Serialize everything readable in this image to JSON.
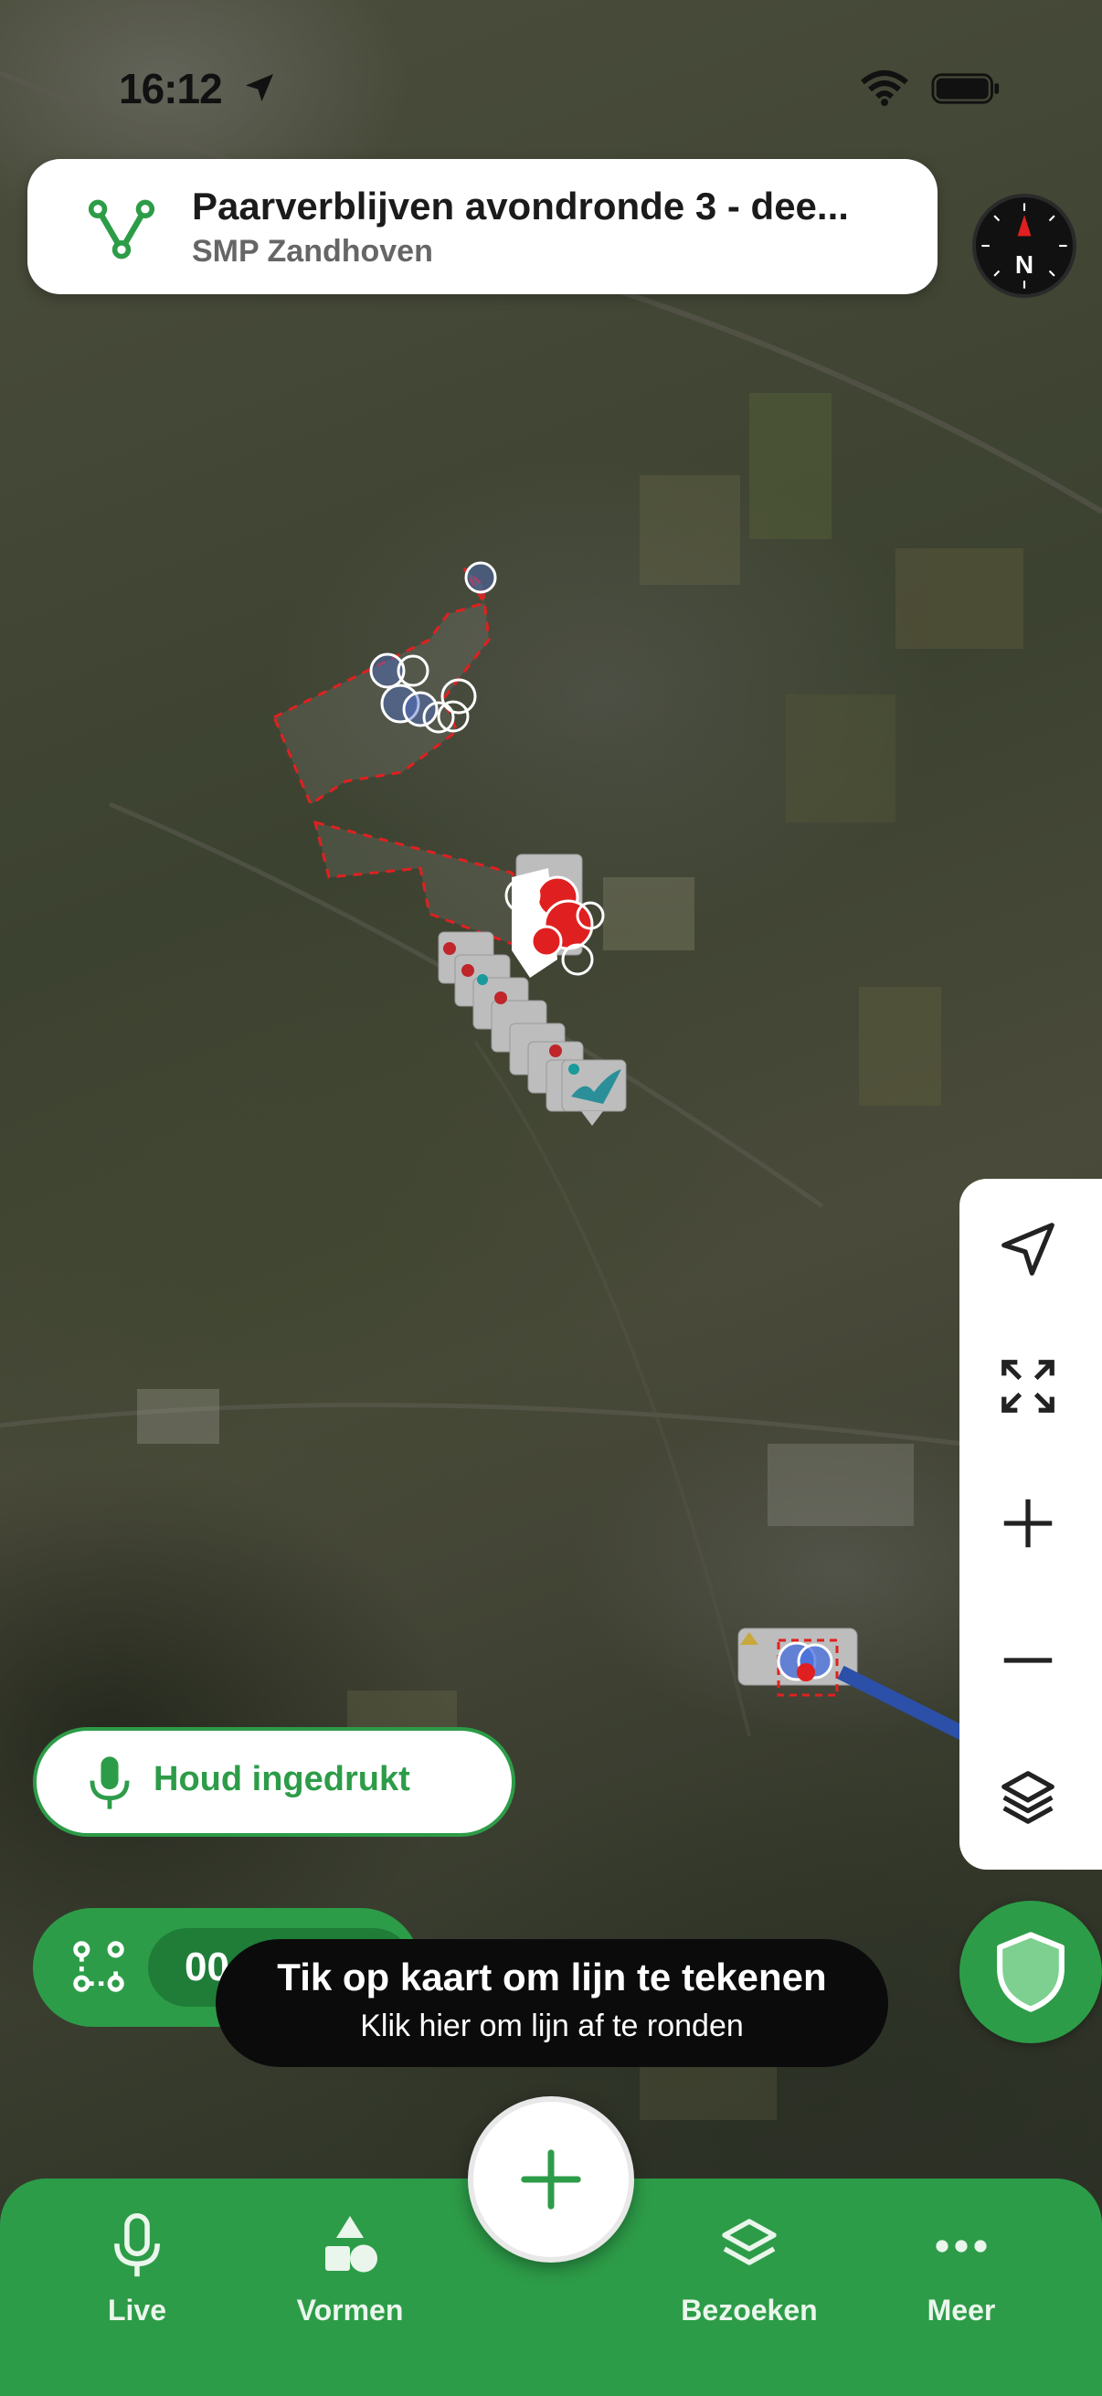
{
  "status_bar": {
    "time": "16:12"
  },
  "header": {
    "title": "Paarverblijven avondronde 3 - dee...",
    "subtitle": "SMP Zandhoven",
    "route_icon": "route-v-icon"
  },
  "compass": {
    "label": "N"
  },
  "map_controls": {
    "items": [
      "locate-arrow-icon",
      "fit-extent-icon",
      "zoom-in-icon",
      "zoom-out-icon",
      "layers-icon"
    ]
  },
  "voice_button": {
    "label": "Houd ingedrukt",
    "icon": "microphone-icon"
  },
  "route_pill": {
    "value": "00",
    "icon": "route-points-icon"
  },
  "tooltip": {
    "title": "Tik op kaart om lijn te tekenen",
    "subtitle": "Klik hier om lijn af te ronden"
  },
  "bottom_nav": {
    "items": [
      {
        "label": "Live",
        "icon": "microphone-icon"
      },
      {
        "label": "Vormen",
        "icon": "shapes-icon"
      },
      {
        "label": "Bezoeken",
        "icon": "layers-icon"
      },
      {
        "label": "Meer",
        "icon": "more-dots-icon"
      }
    ],
    "fab_icon": "plus-icon"
  },
  "colors": {
    "brand_green": "#2d9c48",
    "dark_green": "#1f7d37",
    "marker_red": "#e02020",
    "marker_blue": "#3b6fd8"
  }
}
